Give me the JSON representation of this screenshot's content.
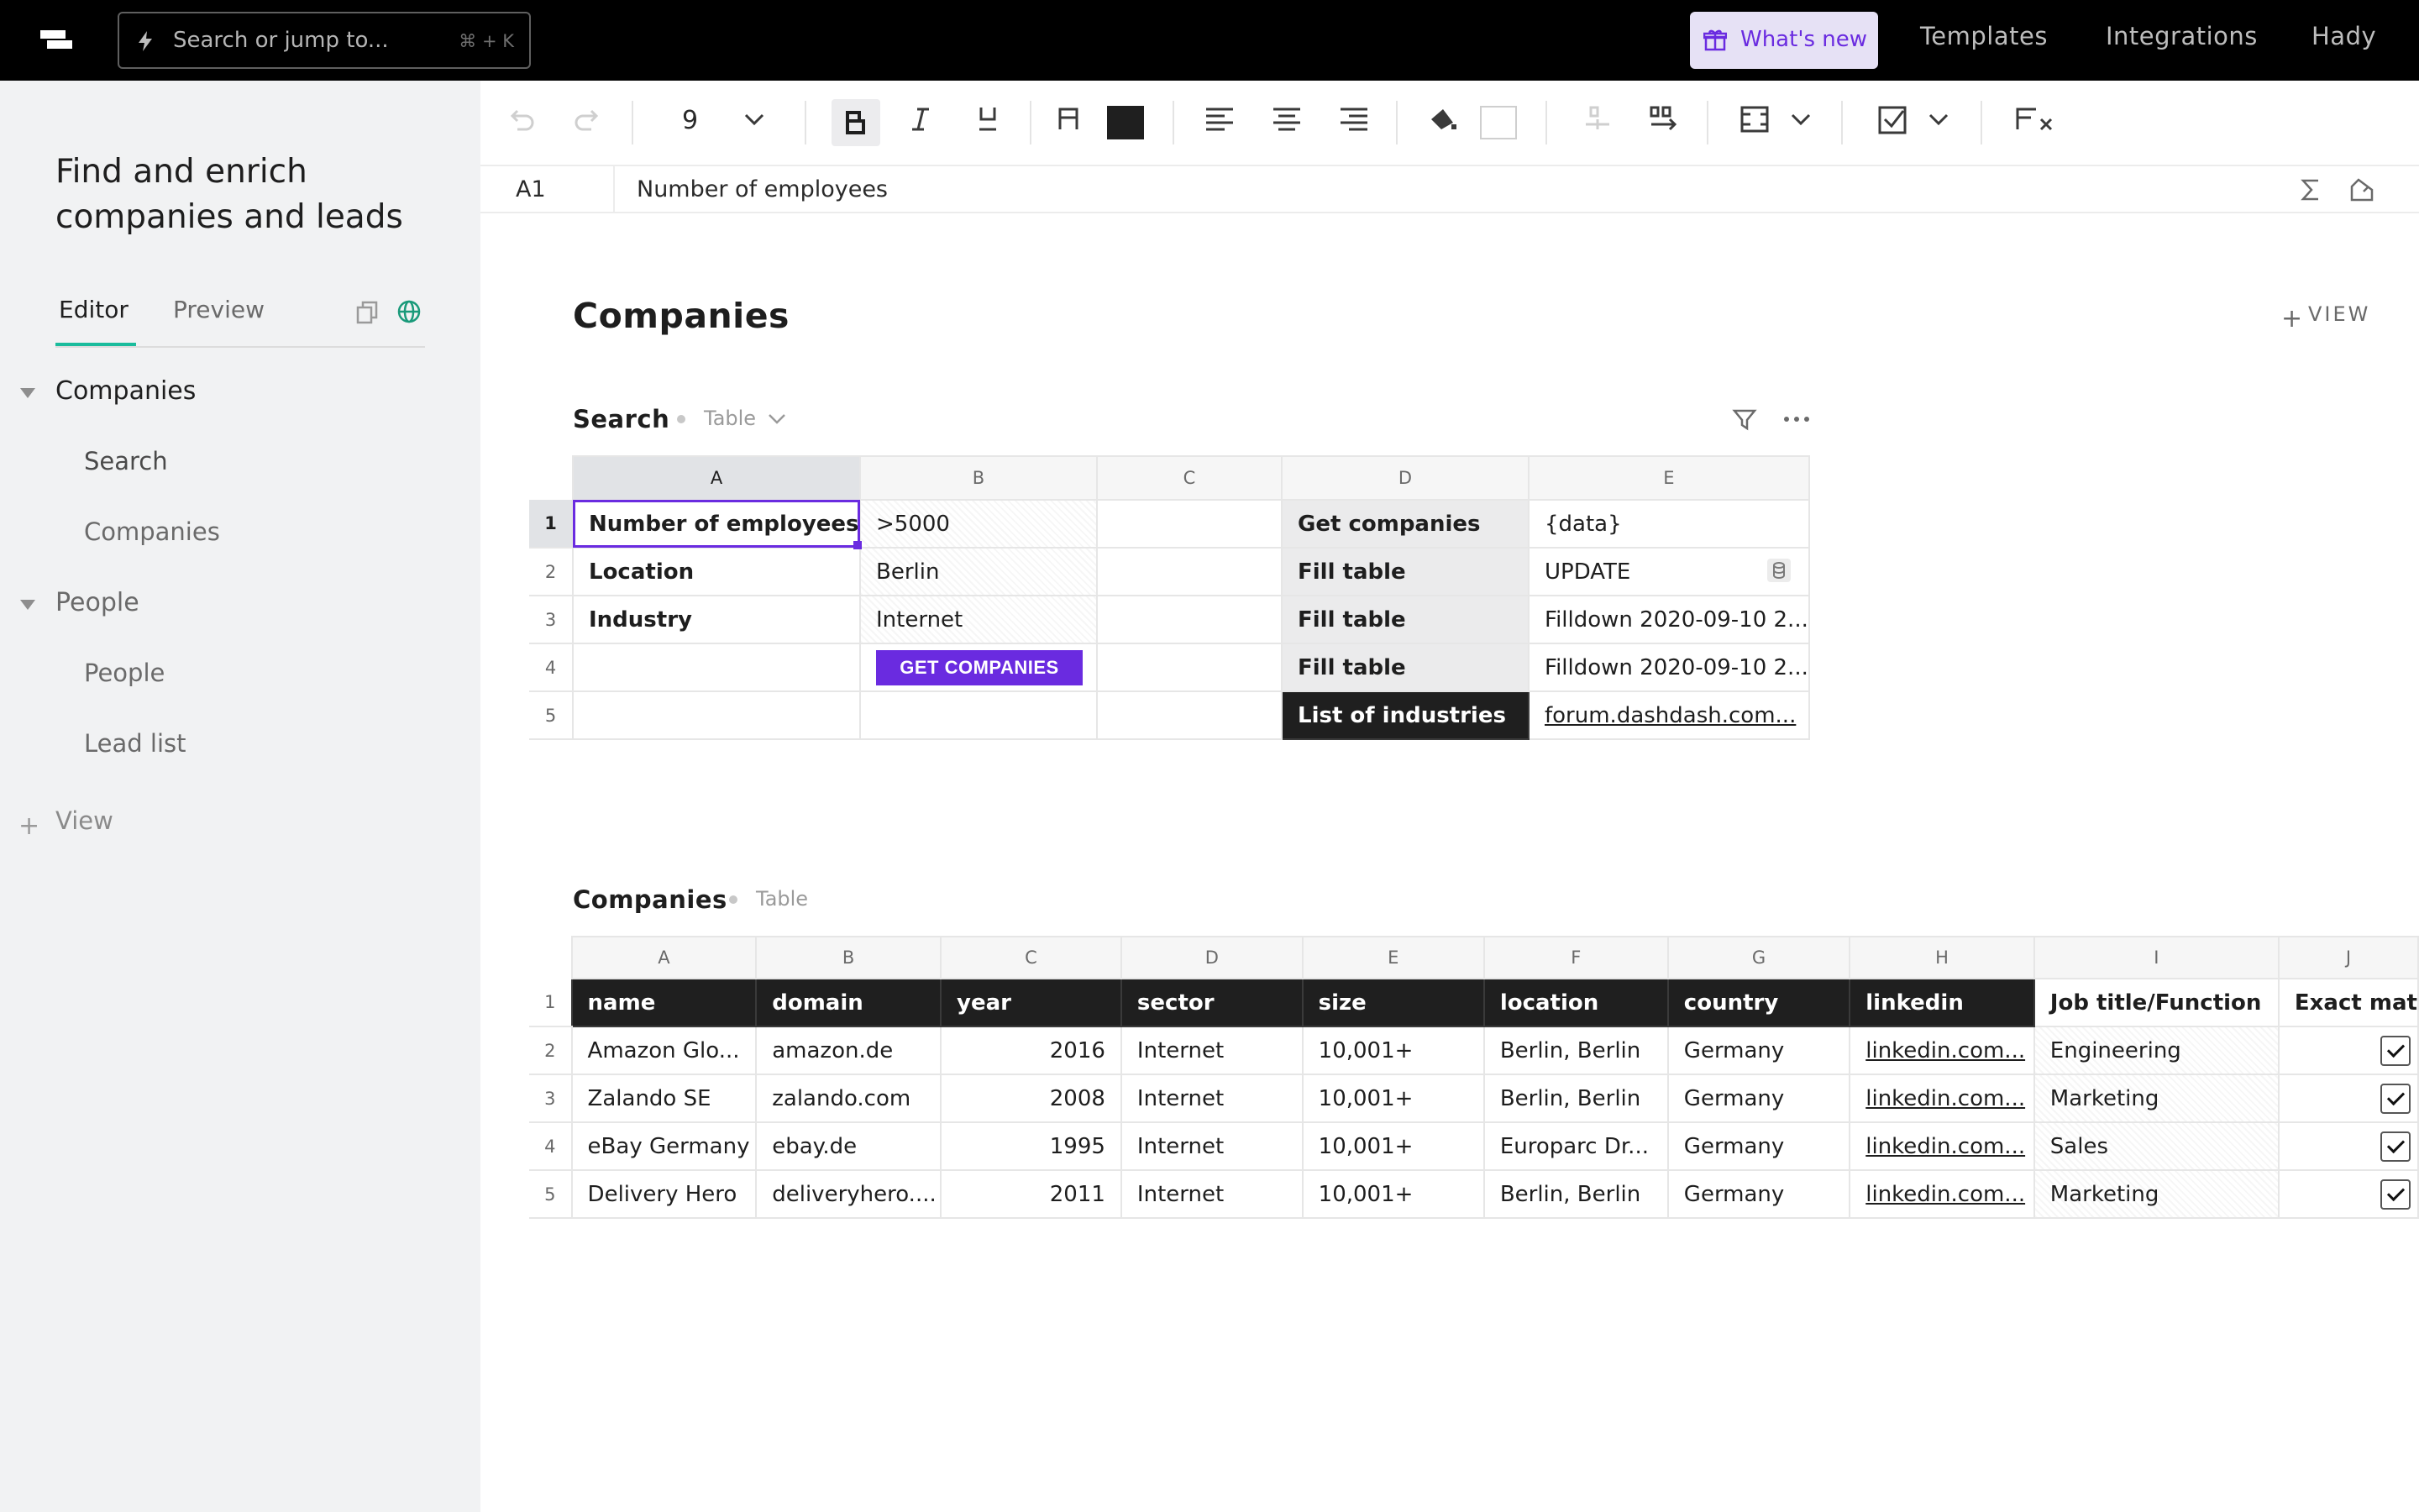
{
  "topbar": {
    "search_placeholder": "Search or jump to...",
    "search_shortcut": "⌘ + K",
    "whats_new": "What's new",
    "nav": [
      "Templates",
      "Integrations",
      "Hady"
    ]
  },
  "sidebar": {
    "doc_title": "Find and enrich companies and leads",
    "tabs": {
      "editor": "Editor",
      "preview": "Preview"
    },
    "groups": [
      {
        "label": "Companies",
        "items": [
          "Search",
          "Companies"
        ]
      },
      {
        "label": "People",
        "items": [
          "People",
          "Lead list"
        ]
      }
    ],
    "add_view": "View"
  },
  "toolbar": {
    "font_size": "9",
    "text_color": "#1f1f1f"
  },
  "formula_bar": {
    "cell_ref": "A1",
    "value": "Number of employees"
  },
  "main": {
    "title": "Companies",
    "add_view": "VIEW",
    "search_section": {
      "title": "Search",
      "type": "Table",
      "columns": [
        "A",
        "B",
        "C",
        "D",
        "E"
      ],
      "rows": [
        {
          "n": "1",
          "a": "Number of employees",
          "b": ">5000",
          "c": "",
          "d": "Get companies",
          "e": "{data}"
        },
        {
          "n": "2",
          "a": "Location",
          "b": "Berlin",
          "c": "",
          "d": "Fill table",
          "e": "UPDATE"
        },
        {
          "n": "3",
          "a": "Industry",
          "b": "Internet",
          "c": "",
          "d": "Fill table",
          "e": "Filldown 2020-09-10 2..."
        },
        {
          "n": "4",
          "a": "",
          "b": "",
          "c": "",
          "d": "Fill table",
          "e": "Filldown 2020-09-10 2..."
        },
        {
          "n": "5",
          "a": "",
          "b": "",
          "c": "",
          "d": "List of industries",
          "e": "forum.dashdash.com..."
        }
      ],
      "button": "GET COMPANIES"
    },
    "companies_section": {
      "title": "Companies",
      "type": "Table",
      "columns": [
        "A",
        "B",
        "C",
        "D",
        "E",
        "F",
        "G",
        "H",
        "I",
        "J"
      ],
      "headers": [
        "name",
        "domain",
        "year",
        "sector",
        "size",
        "location",
        "country",
        "linkedin",
        "Job title/Function",
        "Exact mat"
      ],
      "rows": [
        {
          "n": "2",
          "cells": [
            "Amazon Glo...",
            "amazon.de",
            "2016",
            "Internet",
            "10,001+",
            "Berlin, Berlin",
            "Germany",
            "linkedin.com...",
            "Engineering"
          ],
          "checked": true
        },
        {
          "n": "3",
          "cells": [
            "Zalando SE",
            "zalando.com",
            "2008",
            "Internet",
            "10,001+",
            "Berlin,  Berlin",
            "Germany",
            "linkedin.com...",
            "Marketing"
          ],
          "checked": true
        },
        {
          "n": "4",
          "cells": [
            "eBay Germany",
            "ebay.de",
            "1995",
            "Internet",
            "10,001+",
            "Europarc Dr...",
            "Germany",
            "linkedin.com...",
            "Sales"
          ],
          "checked": true
        },
        {
          "n": "5",
          "cells": [
            "Delivery Hero",
            "deliveryhero....",
            "2011",
            "Internet",
            "10,001+",
            "Berlin, Berlin",
            "Germany",
            "linkedin.com...",
            "Marketing"
          ],
          "checked": true
        }
      ]
    }
  },
  "colors": {
    "accent": "#6a2be0",
    "teal": "#1abc9c",
    "topbar": "#000000",
    "sidebar": "#f1f2f3"
  }
}
